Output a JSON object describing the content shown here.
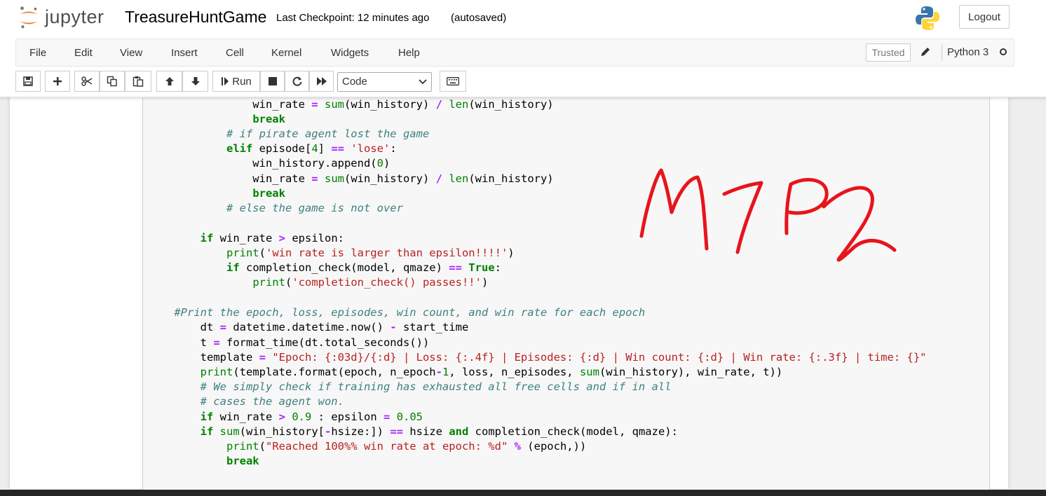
{
  "header": {
    "logo_text": "jupyter",
    "notebook_title": "TreasureHuntGame",
    "checkpoint_text": "Last Checkpoint: 12 minutes ago",
    "autosave_status": "(autosaved)",
    "logout_label": "Logout"
  },
  "menu": [
    "File",
    "Edit",
    "View",
    "Insert",
    "Cell",
    "Kernel",
    "Widgets",
    "Help"
  ],
  "status": {
    "trusted_label": "Trusted",
    "kernel_name": "Python 3"
  },
  "toolbar": {
    "run_label": "Run",
    "cell_type": "Code",
    "icons": [
      "save-icon",
      "plus-icon",
      "scissors-icon",
      "copy-icon",
      "paste-icon",
      "arrow-up-icon",
      "arrow-down-icon",
      "run-icon",
      "stop-icon",
      "restart-icon",
      "fast-forward-icon",
      "keyboard-icon"
    ]
  },
  "code_lines": [
    "                win_rate = sum(win_history) / len(win_history)",
    "                break",
    "            # if pirate agent lost the game",
    "            elif episode[4] == 'lose':",
    "                win_history.append(0)",
    "                win_rate = sum(win_history) / len(win_history)",
    "                break",
    "            # else the game is not over",
    "",
    "        if win_rate > epsilon:",
    "            print('win rate is larger than epsilon!!!!')",
    "            if completion_check(model, qmaze) == True:",
    "                print('completion_check() passes!!')",
    "",
    "    #Print the epoch, loss, episodes, win count, and win rate for each epoch",
    "        dt = datetime.datetime.now() - start_time",
    "        t = format_time(dt.total_seconds())",
    "        template = \"Epoch: {:03d}/{:d} | Loss: {:.4f} | Episodes: {:d} | Win count: {:d} | Win rate: {:.3f} | time: {}\"",
    "        print(template.format(epoch, n_epoch-1, loss, n_episodes, sum(win_history), win_rate, t))",
    "        # We simply check if training has exhausted all free cells and if in all",
    "        # cases the agent won.",
    "        if win_rate > 0.9 : epsilon = 0.05",
    "        if sum(win_history[-hsize:]) == hsize and completion_check(model, qmaze):",
    "            print(\"Reached 100%% win rate at epoch: %d\" % (epoch,))",
    "            break"
  ],
  "annotation_text": "M7P2"
}
